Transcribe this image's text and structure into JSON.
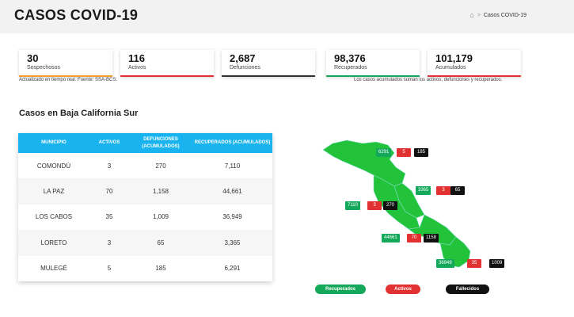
{
  "header": {
    "title": "CASOS COVID-19",
    "breadcrumb": {
      "home_icon": "home-icon",
      "separator": ">",
      "current": "Casos COVID-19"
    }
  },
  "stats": [
    {
      "value": "30",
      "label": "Sospechosos",
      "color": "#f0a030"
    },
    {
      "value": "116",
      "label": "Activos",
      "color": "#e23131"
    },
    {
      "value": "2,687",
      "label": "Defunciones",
      "color": "#333333"
    },
    {
      "value": "98,376",
      "label": "Recuperados",
      "color": "#14a85a"
    },
    {
      "value": "101,179",
      "label": "Acumulados",
      "color": "#e23131"
    }
  ],
  "notes": {
    "left": "Actualizado en tiempo real. Fuente: SSA-BCS.",
    "right": "Los casos acumulados suman los activos, defunciones y recuperados."
  },
  "section_title": "Casos en Baja California Sur",
  "table": {
    "headers": [
      "MUNICIPIO",
      "ACTIVOS",
      "DEFUNCIONES (ACUMULADOS)",
      "RECUPERADOS (ACUMULADOS)"
    ],
    "rows": [
      [
        "COMONDÚ",
        "3",
        "270",
        "7,110"
      ],
      [
        "LA PAZ",
        "70",
        "1,158",
        "44,661"
      ],
      [
        "LOS CABOS",
        "35",
        "1,009",
        "36,949"
      ],
      [
        "LORETO",
        "3",
        "65",
        "3,365"
      ],
      [
        "MULEGÉ",
        "5",
        "185",
        "6,291"
      ]
    ]
  },
  "map": {
    "colors": {
      "land": "#22c33a",
      "border": "#7fe0c8",
      "recuperados": "#14a85a",
      "activos": "#e23131",
      "fallecidos": "#111111"
    },
    "markers": {
      "mulege": {
        "recuperados": "6291",
        "activos": "5",
        "fallecidos": "185"
      },
      "loreto": {
        "recuperados": "3365",
        "activos": "3",
        "fallecidos": "65"
      },
      "comondu": {
        "recuperados": "7110",
        "activos": "3",
        "fallecidos": "270"
      },
      "lapaz": {
        "recuperados": "44661",
        "activos": "70",
        "fallecidos": "1158"
      },
      "loscabos": {
        "recuperados": "36949",
        "activos": "35",
        "fallecidos": "1009"
      }
    }
  },
  "legend": {
    "recuperados": "Recuperados",
    "activos": "Activos",
    "fallecidos": "Fallecidos"
  }
}
